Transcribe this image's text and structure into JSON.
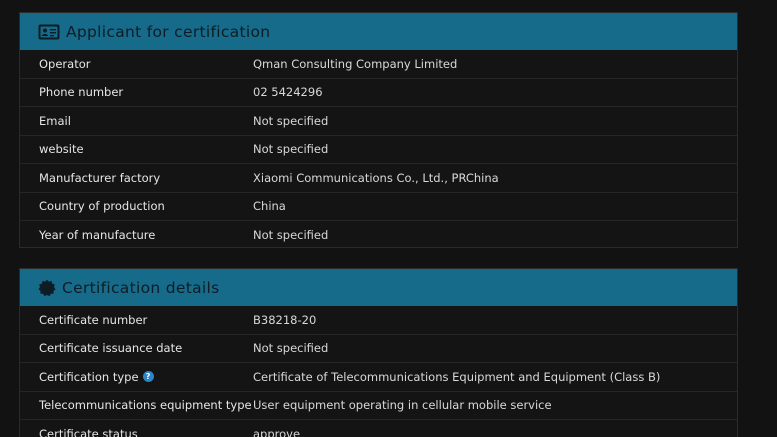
{
  "applicant": {
    "title": "Applicant for certification",
    "rows": [
      {
        "label": "Operator",
        "value": "Qman Consulting Company Limited"
      },
      {
        "label": "Phone number",
        "value": "02 5424296"
      },
      {
        "label": "Email",
        "value": "Not specified"
      },
      {
        "label": "website",
        "value": "Not specified"
      },
      {
        "label": "Manufacturer factory",
        "value": "Xiaomi Communications Co., Ltd., PRChina"
      },
      {
        "label": "Country of production",
        "value": "China"
      },
      {
        "label": "Year of manufacture",
        "value": "Not specified"
      }
    ]
  },
  "certification": {
    "title": "Certification details",
    "rows": [
      {
        "label": "Certificate number",
        "value": "B38218-20"
      },
      {
        "label": "Certificate issuance date",
        "value": "Not specified"
      },
      {
        "label": "Certification type",
        "value": "Certificate of Telecommunications Equipment and Equipment (Class B)",
        "help": "?"
      },
      {
        "label": "Telecommunications equipment type",
        "value": "User equipment operating in cellular mobile service"
      },
      {
        "label": "Certificate status",
        "value": "approve"
      }
    ]
  },
  "colors": {
    "header": "#166a8a",
    "background": "#121212",
    "help_badge": "#2b86c5"
  },
  "icons": {
    "applicant": "id-card-icon",
    "certification": "badge-seal-icon",
    "help": "question-circle-icon"
  }
}
